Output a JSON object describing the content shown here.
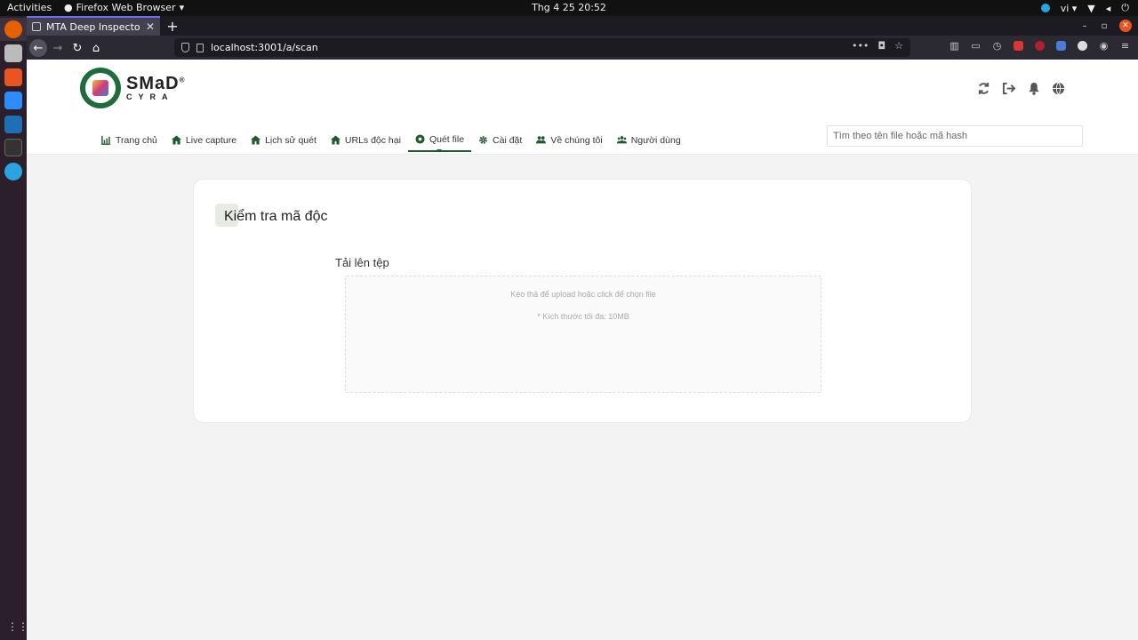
{
  "topbar": {
    "activities": "Activities",
    "app_name": "Firefox Web Browser",
    "clock": "Thg 4 25  20:52",
    "lang": "vi"
  },
  "browser": {
    "tab_title": "MTA Deep Inspector",
    "url": "localhost:3001/a/scan"
  },
  "header": {
    "brand_main": "SMaD",
    "brand_reg": "®",
    "brand_sub": "CYRA"
  },
  "menu": [
    {
      "label": "Trang chủ",
      "icon": "chart-icon"
    },
    {
      "label": "Live capture",
      "icon": "home-icon"
    },
    {
      "label": "Lịch sử quét",
      "icon": "home-icon"
    },
    {
      "label": "URLs độc hại",
      "icon": "home-icon"
    },
    {
      "label": "Quét file",
      "icon": "virus-icon",
      "active": true
    },
    {
      "label": "Cài đặt",
      "icon": "gear-icon"
    },
    {
      "label": "Về chúng tôi",
      "icon": "users-icon"
    },
    {
      "label": "Người dùng",
      "icon": "users-icon"
    }
  ],
  "search": {
    "placeholder": "Tìm theo tên file hoặc mã hash"
  },
  "card": {
    "title": "Kiểm tra mã độc",
    "upload_label": "Tải lên tệp",
    "drop_hint": "Kéo thả để upload hoặc click để chọn file",
    "size_hint": "* Kích thước tối đa: 10MB"
  },
  "colors": {
    "accent": "#1e5c2c",
    "ubuntu_orange": "#e95420"
  }
}
